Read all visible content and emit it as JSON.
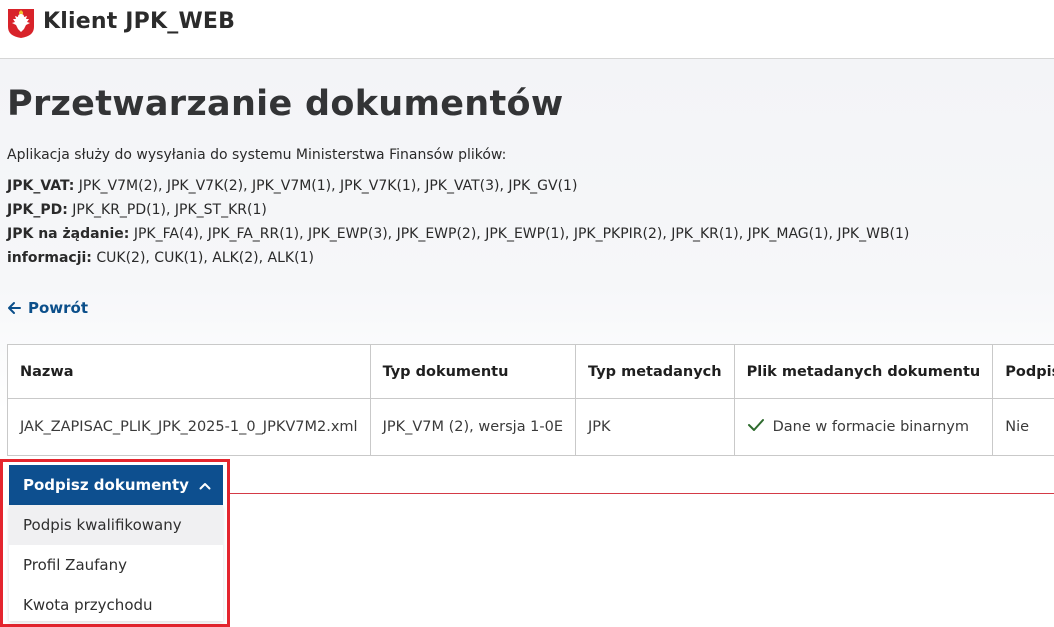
{
  "header": {
    "app_title": "Klient JPK_WEB"
  },
  "main": {
    "title": "Przetwarzanie dokumentów",
    "intro": "Aplikacja służy do wysyłania do systemu Ministerstwa Finansów plików:",
    "categories": [
      {
        "label": "JPK_VAT:",
        "items": "JPK_V7M(2), JPK_V7K(2), JPK_V7M(1), JPK_V7K(1), JPK_VAT(3), JPK_GV(1)"
      },
      {
        "label": "JPK_PD:",
        "items": "JPK_KR_PD(1), JPK_ST_KR(1)"
      },
      {
        "label": "JPK na żądanie:",
        "items": "JPK_FA(4), JPK_FA_RR(1), JPK_EWP(3), JPK_EWP(2), JPK_EWP(1), JPK_PKPIR(2), JPK_KR(1), JPK_MAG(1), JPK_WB(1)"
      },
      {
        "label": "informacji:",
        "items": "CUK(2), CUK(1), ALK(2), ALK(1)"
      }
    ],
    "back_label": "Powrót"
  },
  "table": {
    "headers": [
      "Nazwa",
      "Typ dokumentu",
      "Typ metadanych",
      "Plik metadanych dokumentu",
      "Podpis"
    ],
    "rows": [
      {
        "name": "JAK_ZAPISAC_PLIK_JPK_2025-1_0_JPKV7M2.xml",
        "doc_type": "JPK_V7M (2), wersja 1-0E",
        "meta_type": "JPK",
        "meta_file": "Dane w formacie binarnym",
        "signature": "Nie"
      }
    ]
  },
  "sign_menu": {
    "button_label": "Podpisz dokumenty",
    "items": [
      "Podpis kwalifikowany",
      "Profil Zaufany",
      "Kwota przychodu"
    ]
  },
  "colors": {
    "primary": "#0d4f8f",
    "highlight_border": "#e4252e",
    "success": "#2e6b2e",
    "danger": "#b0291c"
  },
  "icons": {
    "emblem": "polish-eagle-emblem",
    "back": "arrow-left-icon",
    "dropdown": "chevron-up-icon",
    "status": "checkmark-icon"
  }
}
